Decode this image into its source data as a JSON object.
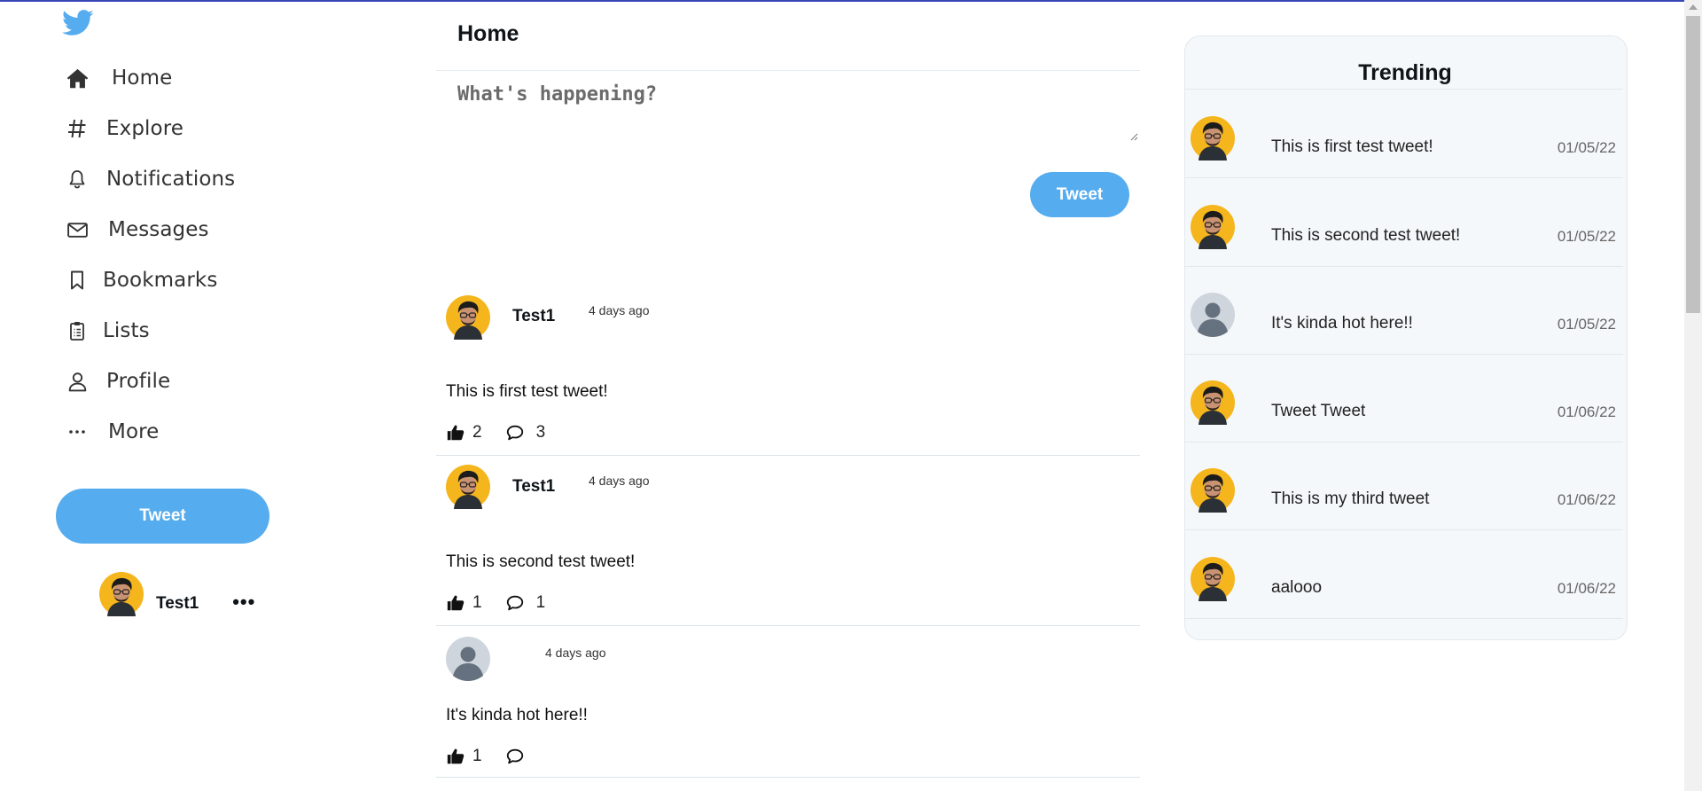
{
  "colors": {
    "accent": "#55acee",
    "avatar_yellow": "#f5b51d",
    "default_avatar_bg": "#ced5dc"
  },
  "sidebar": {
    "logo_icon": "twitter-bird-icon",
    "nav": [
      {
        "label": "Home",
        "icon": "home-icon"
      },
      {
        "label": "Explore",
        "icon": "hashtag-icon"
      },
      {
        "label": "Notifications",
        "icon": "bell-icon"
      },
      {
        "label": "Messages",
        "icon": "envelope-icon"
      },
      {
        "label": "Bookmarks",
        "icon": "bookmark-icon"
      },
      {
        "label": "Lists",
        "icon": "list-clipboard-icon"
      },
      {
        "label": "Profile",
        "icon": "user-icon"
      },
      {
        "label": "More",
        "icon": "more-dots-icon"
      }
    ],
    "tweet_button": "Tweet",
    "user": {
      "name": "Test1",
      "more": "•••"
    }
  },
  "main": {
    "title": "Home",
    "compose_placeholder": "What's happening?",
    "tweet_button": "Tweet",
    "posts": [
      {
        "author": "Test1",
        "time": "4 days ago",
        "text": "This is first test tweet!",
        "likes": "2",
        "comments": "3",
        "avatar": "photo"
      },
      {
        "author": "Test1",
        "time": "4 days ago",
        "text": "This is second test tweet!",
        "likes": "1",
        "comments": "1",
        "avatar": "photo"
      },
      {
        "author": "",
        "time": "4 days ago",
        "text": "It's kinda hot here!!",
        "likes": "1",
        "comments": "",
        "avatar": "default"
      }
    ]
  },
  "trending": {
    "title": "Trending",
    "items": [
      {
        "text": "This is first test tweet!",
        "date": "01/05/22",
        "avatar": "photo"
      },
      {
        "text": "This is second test tweet!",
        "date": "01/05/22",
        "avatar": "photo"
      },
      {
        "text": "It's kinda hot here!!",
        "date": "01/05/22",
        "avatar": "default"
      },
      {
        "text": "Tweet Tweet",
        "date": "01/06/22",
        "avatar": "photo"
      },
      {
        "text": "This is my third tweet",
        "date": "01/06/22",
        "avatar": "photo"
      },
      {
        "text": "aalooo",
        "date": "01/06/22",
        "avatar": "photo"
      }
    ]
  }
}
